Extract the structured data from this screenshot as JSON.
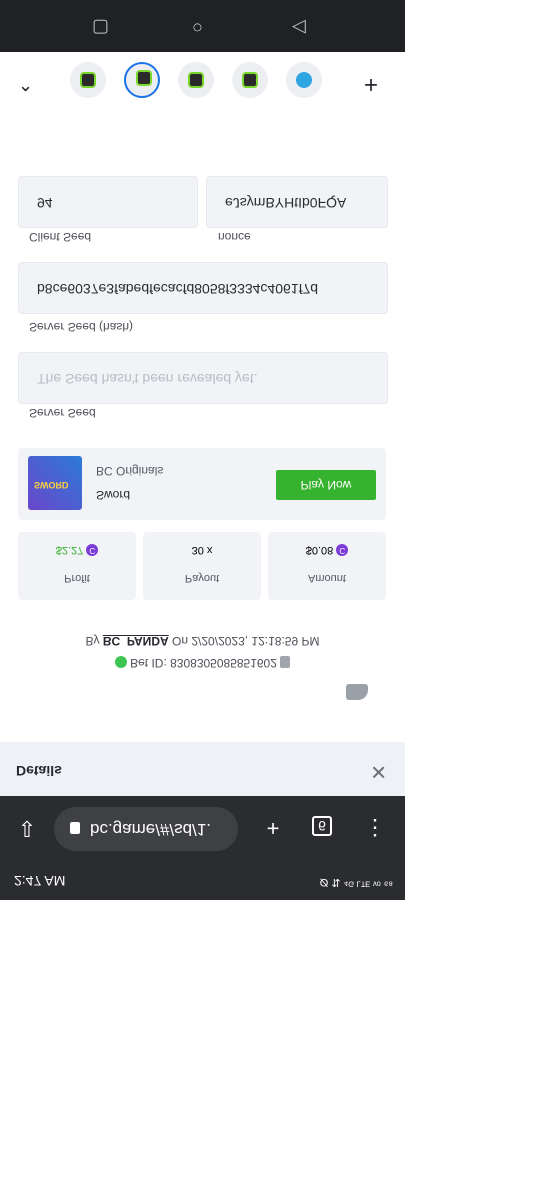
{
  "status_bar": {
    "time": "2:47 AM",
    "right_text": "Ø ⇅ ⁴ᴳ ᴸᵀᴱ ᵛᵒ ⁶⁸"
  },
  "browser": {
    "url": "bc.game/#/sd/1.",
    "tab_count": "6"
  },
  "details": {
    "title": "Details"
  },
  "bet": {
    "by_label": "By",
    "user": "BC_PANDA",
    "on_label": "On",
    "datetime": "2/20/2023, 12:18:59 PM",
    "bet_id_label": "Bet ID:",
    "bet_id": "8308305085851602"
  },
  "stats": {
    "amount": {
      "label": "Amount",
      "value": "$0.08"
    },
    "payout": {
      "label": "Payout",
      "value": "30 x"
    },
    "profit": {
      "label": "Profit",
      "value": "$2.27"
    }
  },
  "game": {
    "title": "Sword",
    "provider": "BC Originals",
    "play_label": "Play Now",
    "thumb_text": "SWORD"
  },
  "seeds": {
    "server_seed": {
      "label": "Server Seed",
      "placeholder": "The Seed hasn't been revealed yet."
    },
    "server_seed_hash": {
      "label": "Server Seed (hash)",
      "value": "b8ce6037e3fabedfecacfd8058f3334c4061f7d"
    },
    "client_seed": {
      "label": "Client Seed",
      "value": "eJsymBYHtIb0FQA"
    },
    "nonce": {
      "label": "nonce",
      "value": "94"
    }
  },
  "colors": {
    "play": "#36b32e",
    "coin": "#7b3bd6",
    "dark": "#2b2c30"
  }
}
